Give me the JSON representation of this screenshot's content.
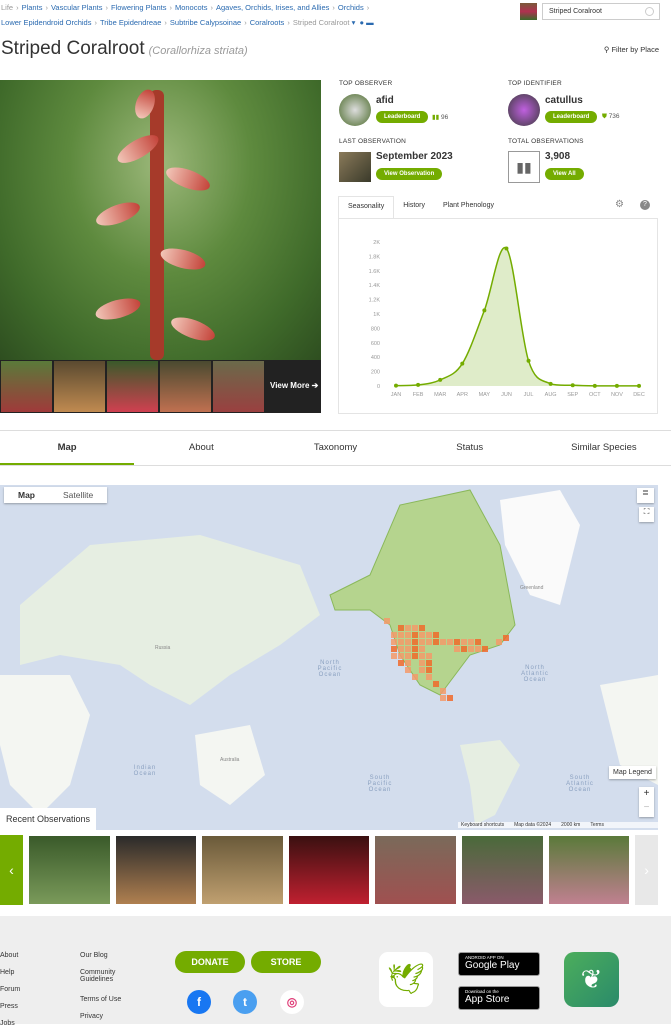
{
  "breadcrumb": [
    "Life",
    "Plants",
    "Vascular Plants",
    "Flowering Plants",
    "Monocots",
    "Agaves, Orchids, Irises, and Allies",
    "Orchids",
    "Lower Epidendroid Orchids",
    "Tribe Epidendreae",
    "Subtribe Calypsoinae",
    "Coralroots",
    "Striped Coralroot"
  ],
  "search": {
    "value": "Striped Coralroot"
  },
  "title": {
    "common": "Striped Coralroot",
    "scientific": "(Corallorhiza striata)"
  },
  "filter_by_place": "Filter by Place",
  "gallery": {
    "view_more": "View More"
  },
  "stats": {
    "top_observer": {
      "label": "TOP OBSERVER",
      "name": "afid",
      "button": "Leaderboard",
      "count": "96"
    },
    "top_identifier": {
      "label": "TOP IDENTIFIER",
      "name": "catullus",
      "button": "Leaderboard",
      "count": "736"
    },
    "last_observation": {
      "label": "LAST OBSERVATION",
      "value": "September 2023",
      "button": "View Observation"
    },
    "total_observations": {
      "label": "TOTAL OBSERVATIONS",
      "value": "3,908",
      "button": "View All"
    }
  },
  "chart_tabs": [
    "Seasonality",
    "History",
    "Plant Phenology"
  ],
  "chart_data": {
    "type": "area",
    "categories": [
      "JAN",
      "FEB",
      "MAR",
      "APR",
      "MAY",
      "JUN",
      "JUL",
      "AUG",
      "SEP",
      "OCT",
      "NOV",
      "DEC"
    ],
    "values": [
      5,
      15,
      85,
      310,
      1050,
      1910,
      350,
      30,
      10,
      2,
      2,
      2
    ],
    "ylim": [
      0,
      2000
    ],
    "yticks": [
      "0",
      "200",
      "400",
      "600",
      "800",
      "1K",
      "1.2K",
      "1.4K",
      "1.6K",
      "1.8K",
      "2K"
    ],
    "color": "#74ac00",
    "grid": false
  },
  "page_tabs": [
    "Map",
    "About",
    "Taxonomy",
    "Status",
    "Similar Species"
  ],
  "map": {
    "type_buttons": [
      "Map",
      "Satellite"
    ],
    "legend": "Map Legend",
    "zoom_in": "+",
    "zoom_out": "−",
    "attribution": [
      "Keyboard shortcuts",
      "Map data ©2024",
      "2000 km",
      "Terms"
    ],
    "labels": [
      "North Pacific Ocean",
      "North Atlantic Ocean",
      "Indian Ocean",
      "South Pacific Ocean",
      "South Atlantic Ocean",
      "Greenland",
      "Russia",
      "Australia"
    ]
  },
  "recent_observations": "Recent Observations",
  "footer": {
    "col1": [
      "About",
      "Help",
      "Forum",
      "Press",
      "Jobs"
    ],
    "col2": [
      "Our Blog",
      "Community Guidelines",
      "Terms of Use",
      "Privacy"
    ],
    "donate": "DONATE",
    "store": "STORE",
    "google_play": {
      "small": "ANDROID APP ON",
      "big": "Google Play"
    },
    "app_store": {
      "small": "Download on the",
      "big": "App Store"
    }
  }
}
